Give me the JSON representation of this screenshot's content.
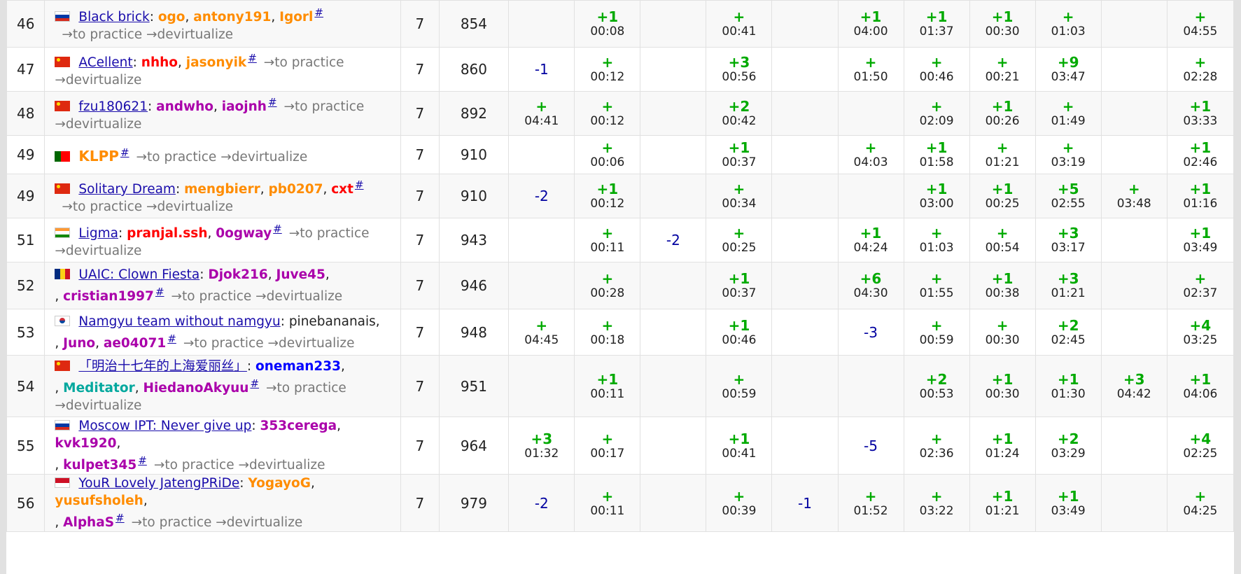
{
  "ui": {
    "to_practice": "→to practice",
    "devirtualize": "→devirtualize",
    "hash": "#"
  },
  "flag_colors": {
    "ru": [
      "#ffffff",
      "#0039a6",
      "#d52b1e"
    ],
    "hk": "#de2910",
    "cn": "#de2910",
    "pt": [
      "#006600",
      "#ff0000"
    ],
    "in": [
      "#ff9933",
      "#ffffff",
      "#138808"
    ],
    "ro": [
      "#002b7f",
      "#fcd116",
      "#ce1126"
    ],
    "kr": "#ffffff",
    "id": [
      "#ce1126",
      "#ffffff"
    ]
  },
  "rows": [
    {
      "rank": "46",
      "flag": "ru",
      "team": "Black brick",
      "members": [
        {
          "name": "ogo",
          "color": "orange"
        },
        {
          "name": "antony191",
          "color": "orange"
        },
        {
          "name": "Igorl",
          "color": "orange"
        }
      ],
      "solved": "7",
      "penalty": "854",
      "cells": [
        null,
        {
          "s": "+1",
          "t": "00:08"
        },
        null,
        {
          "s": "+",
          "t": "00:41"
        },
        null,
        {
          "s": "+1",
          "t": "04:00"
        },
        {
          "s": "+1",
          "t": "01:37"
        },
        {
          "s": "+1",
          "t": "00:30"
        },
        {
          "s": "+",
          "t": "01:03"
        },
        null,
        {
          "s": "+",
          "t": "04:55"
        }
      ]
    },
    {
      "rank": "47",
      "flag": "hk",
      "team": "ACellent",
      "members": [
        {
          "name": "nhho",
          "color": "red"
        },
        {
          "name": "jasonyik",
          "color": "orange"
        }
      ],
      "solved": "7",
      "penalty": "860",
      "cells": [
        {
          "r": "-1"
        },
        {
          "s": "+",
          "t": "00:12"
        },
        null,
        {
          "s": "+3",
          "t": "00:56"
        },
        null,
        {
          "s": "+",
          "t": "01:50"
        },
        {
          "s": "+",
          "t": "00:46"
        },
        {
          "s": "+",
          "t": "00:21"
        },
        {
          "s": "+9",
          "t": "03:47"
        },
        null,
        {
          "s": "+",
          "t": "02:28"
        }
      ]
    },
    {
      "rank": "48",
      "flag": "cn",
      "team": "fzu180621",
      "members": [
        {
          "name": "andwho",
          "color": "violet"
        },
        {
          "name": "iaojnh",
          "color": "violet"
        }
      ],
      "solved": "7",
      "penalty": "892",
      "cells": [
        {
          "s": "+",
          "t": "04:41"
        },
        {
          "s": "+",
          "t": "00:12"
        },
        null,
        {
          "s": "+2",
          "t": "00:42"
        },
        null,
        null,
        {
          "s": "+",
          "t": "02:09"
        },
        {
          "s": "+1",
          "t": "00:26"
        },
        {
          "s": "+",
          "t": "01:49"
        },
        null,
        {
          "s": "+1",
          "t": "03:33"
        }
      ]
    },
    {
      "rank": "49",
      "flag": "pt",
      "team": "KLPP",
      "members": [],
      "solved": "7",
      "penalty": "910",
      "cells": [
        null,
        {
          "s": "+",
          "t": "00:06"
        },
        null,
        {
          "s": "+1",
          "t": "00:37"
        },
        null,
        {
          "s": "+",
          "t": "04:03"
        },
        {
          "s": "+1",
          "t": "01:58"
        },
        {
          "s": "+",
          "t": "01:21"
        },
        {
          "s": "+",
          "t": "03:19"
        },
        null,
        {
          "s": "+1",
          "t": "02:46"
        }
      ]
    },
    {
      "rank": "49",
      "flag": "cn",
      "team": "Solitary Dream",
      "members": [
        {
          "name": "mengbierr",
          "color": "orange"
        },
        {
          "name": "pb0207",
          "color": "orange"
        },
        {
          "name": "cxt",
          "color": "red"
        }
      ],
      "solved": "7",
      "penalty": "910",
      "cells": [
        {
          "r": "-2"
        },
        {
          "s": "+1",
          "t": "00:12"
        },
        null,
        {
          "s": "+",
          "t": "00:34"
        },
        null,
        null,
        {
          "s": "+1",
          "t": "03:00"
        },
        {
          "s": "+1",
          "t": "00:25"
        },
        {
          "s": "+5",
          "t": "02:55"
        },
        {
          "s": "+",
          "t": "03:48"
        },
        {
          "s": "+1",
          "t": "01:16"
        }
      ]
    },
    {
      "rank": "51",
      "flag": "in",
      "team": "Ligma",
      "members": [
        {
          "name": "pranjal.ssh",
          "color": "red"
        },
        {
          "name": "0ogway",
          "color": "violet"
        }
      ],
      "solved": "7",
      "penalty": "943",
      "cells": [
        null,
        {
          "s": "+",
          "t": "00:11"
        },
        {
          "r": "-2"
        },
        {
          "s": "+",
          "t": "00:25"
        },
        null,
        {
          "s": "+1",
          "t": "04:24"
        },
        {
          "s": "+",
          "t": "01:03"
        },
        {
          "s": "+",
          "t": "00:54"
        },
        {
          "s": "+3",
          "t": "03:17"
        },
        null,
        {
          "s": "+1",
          "t": "03:49"
        }
      ]
    },
    {
      "rank": "52",
      "flag": "ro",
      "team": "UAIC: Clown Fiesta",
      "members": [
        {
          "name": "Djok216",
          "color": "violet"
        },
        {
          "name": "Juve45",
          "color": "violet"
        },
        {
          "name": "cristian1997",
          "color": "violet"
        }
      ],
      "solved": "7",
      "penalty": "946",
      "cells": [
        null,
        {
          "s": "+",
          "t": "00:28"
        },
        null,
        {
          "s": "+1",
          "t": "00:37"
        },
        null,
        {
          "s": "+6",
          "t": "04:30"
        },
        {
          "s": "+",
          "t": "01:55"
        },
        {
          "s": "+1",
          "t": "00:38"
        },
        {
          "s": "+3",
          "t": "01:21"
        },
        null,
        {
          "s": "+",
          "t": "02:37"
        }
      ]
    },
    {
      "rank": "53",
      "flag": "kr",
      "team": "Namgyu team without namgyu",
      "members": [
        {
          "name": "pinebananais",
          "color": "black"
        },
        {
          "name": "Juno",
          "color": "violet"
        },
        {
          "name": "ae04071",
          "color": "violet"
        }
      ],
      "solved": "7",
      "penalty": "948",
      "cells": [
        {
          "s": "+",
          "t": "04:45"
        },
        {
          "s": "+",
          "t": "00:18"
        },
        null,
        {
          "s": "+1",
          "t": "00:46"
        },
        null,
        {
          "r": "-3"
        },
        {
          "s": "+",
          "t": "00:59"
        },
        {
          "s": "+",
          "t": "00:30"
        },
        {
          "s": "+2",
          "t": "02:45"
        },
        null,
        {
          "s": "+4",
          "t": "03:25"
        }
      ]
    },
    {
      "rank": "54",
      "flag": "cn",
      "team": "「明治十七年的上海爱丽丝」",
      "members": [
        {
          "name": "oneman233",
          "color": "blue"
        },
        {
          "name": "Meditator",
          "color": "teal"
        },
        {
          "name": "HiedanoAkyuu",
          "color": "violet"
        }
      ],
      "solved": "7",
      "penalty": "951",
      "cells": [
        null,
        {
          "s": "+1",
          "t": "00:11"
        },
        null,
        {
          "s": "+",
          "t": "00:59"
        },
        null,
        null,
        {
          "s": "+2",
          "t": "00:53"
        },
        {
          "s": "+1",
          "t": "00:30"
        },
        {
          "s": "+1",
          "t": "01:30"
        },
        {
          "s": "+3",
          "t": "04:42"
        },
        {
          "s": "+1",
          "t": "04:06"
        }
      ]
    },
    {
      "rank": "55",
      "flag": "ru",
      "team": "Moscow IPT: Never give up",
      "members": [
        {
          "name": "353cerega",
          "color": "violet"
        },
        {
          "name": "kvk1920",
          "color": "violet"
        },
        {
          "name": "kulpet345",
          "color": "violet"
        }
      ],
      "solved": "7",
      "penalty": "964",
      "cells": [
        {
          "s": "+3",
          "t": "01:32"
        },
        {
          "s": "+",
          "t": "00:17"
        },
        null,
        {
          "s": "+1",
          "t": "00:41"
        },
        null,
        {
          "r": "-5"
        },
        {
          "s": "+",
          "t": "02:36"
        },
        {
          "s": "+1",
          "t": "01:24"
        },
        {
          "s": "+2",
          "t": "03:29"
        },
        null,
        {
          "s": "+4",
          "t": "02:25"
        }
      ]
    },
    {
      "rank": "56",
      "flag": "id",
      "team": "YouR Lovely JatengPRiDe",
      "members": [
        {
          "name": "YogayoG",
          "color": "orange"
        },
        {
          "name": "yusufsholeh",
          "color": "orange"
        },
        {
          "name": "AlphaS",
          "color": "violet"
        }
      ],
      "solved": "7",
      "penalty": "979",
      "cells": [
        {
          "r": "-2"
        },
        {
          "s": "+",
          "t": "00:11"
        },
        null,
        {
          "s": "+",
          "t": "00:39"
        },
        {
          "r": "-1"
        },
        {
          "s": "+",
          "t": "01:52"
        },
        {
          "s": "+",
          "t": "03:22"
        },
        {
          "s": "+1",
          "t": "01:21"
        },
        {
          "s": "+1",
          "t": "03:49"
        },
        null,
        {
          "s": "+",
          "t": "04:25"
        }
      ]
    }
  ]
}
